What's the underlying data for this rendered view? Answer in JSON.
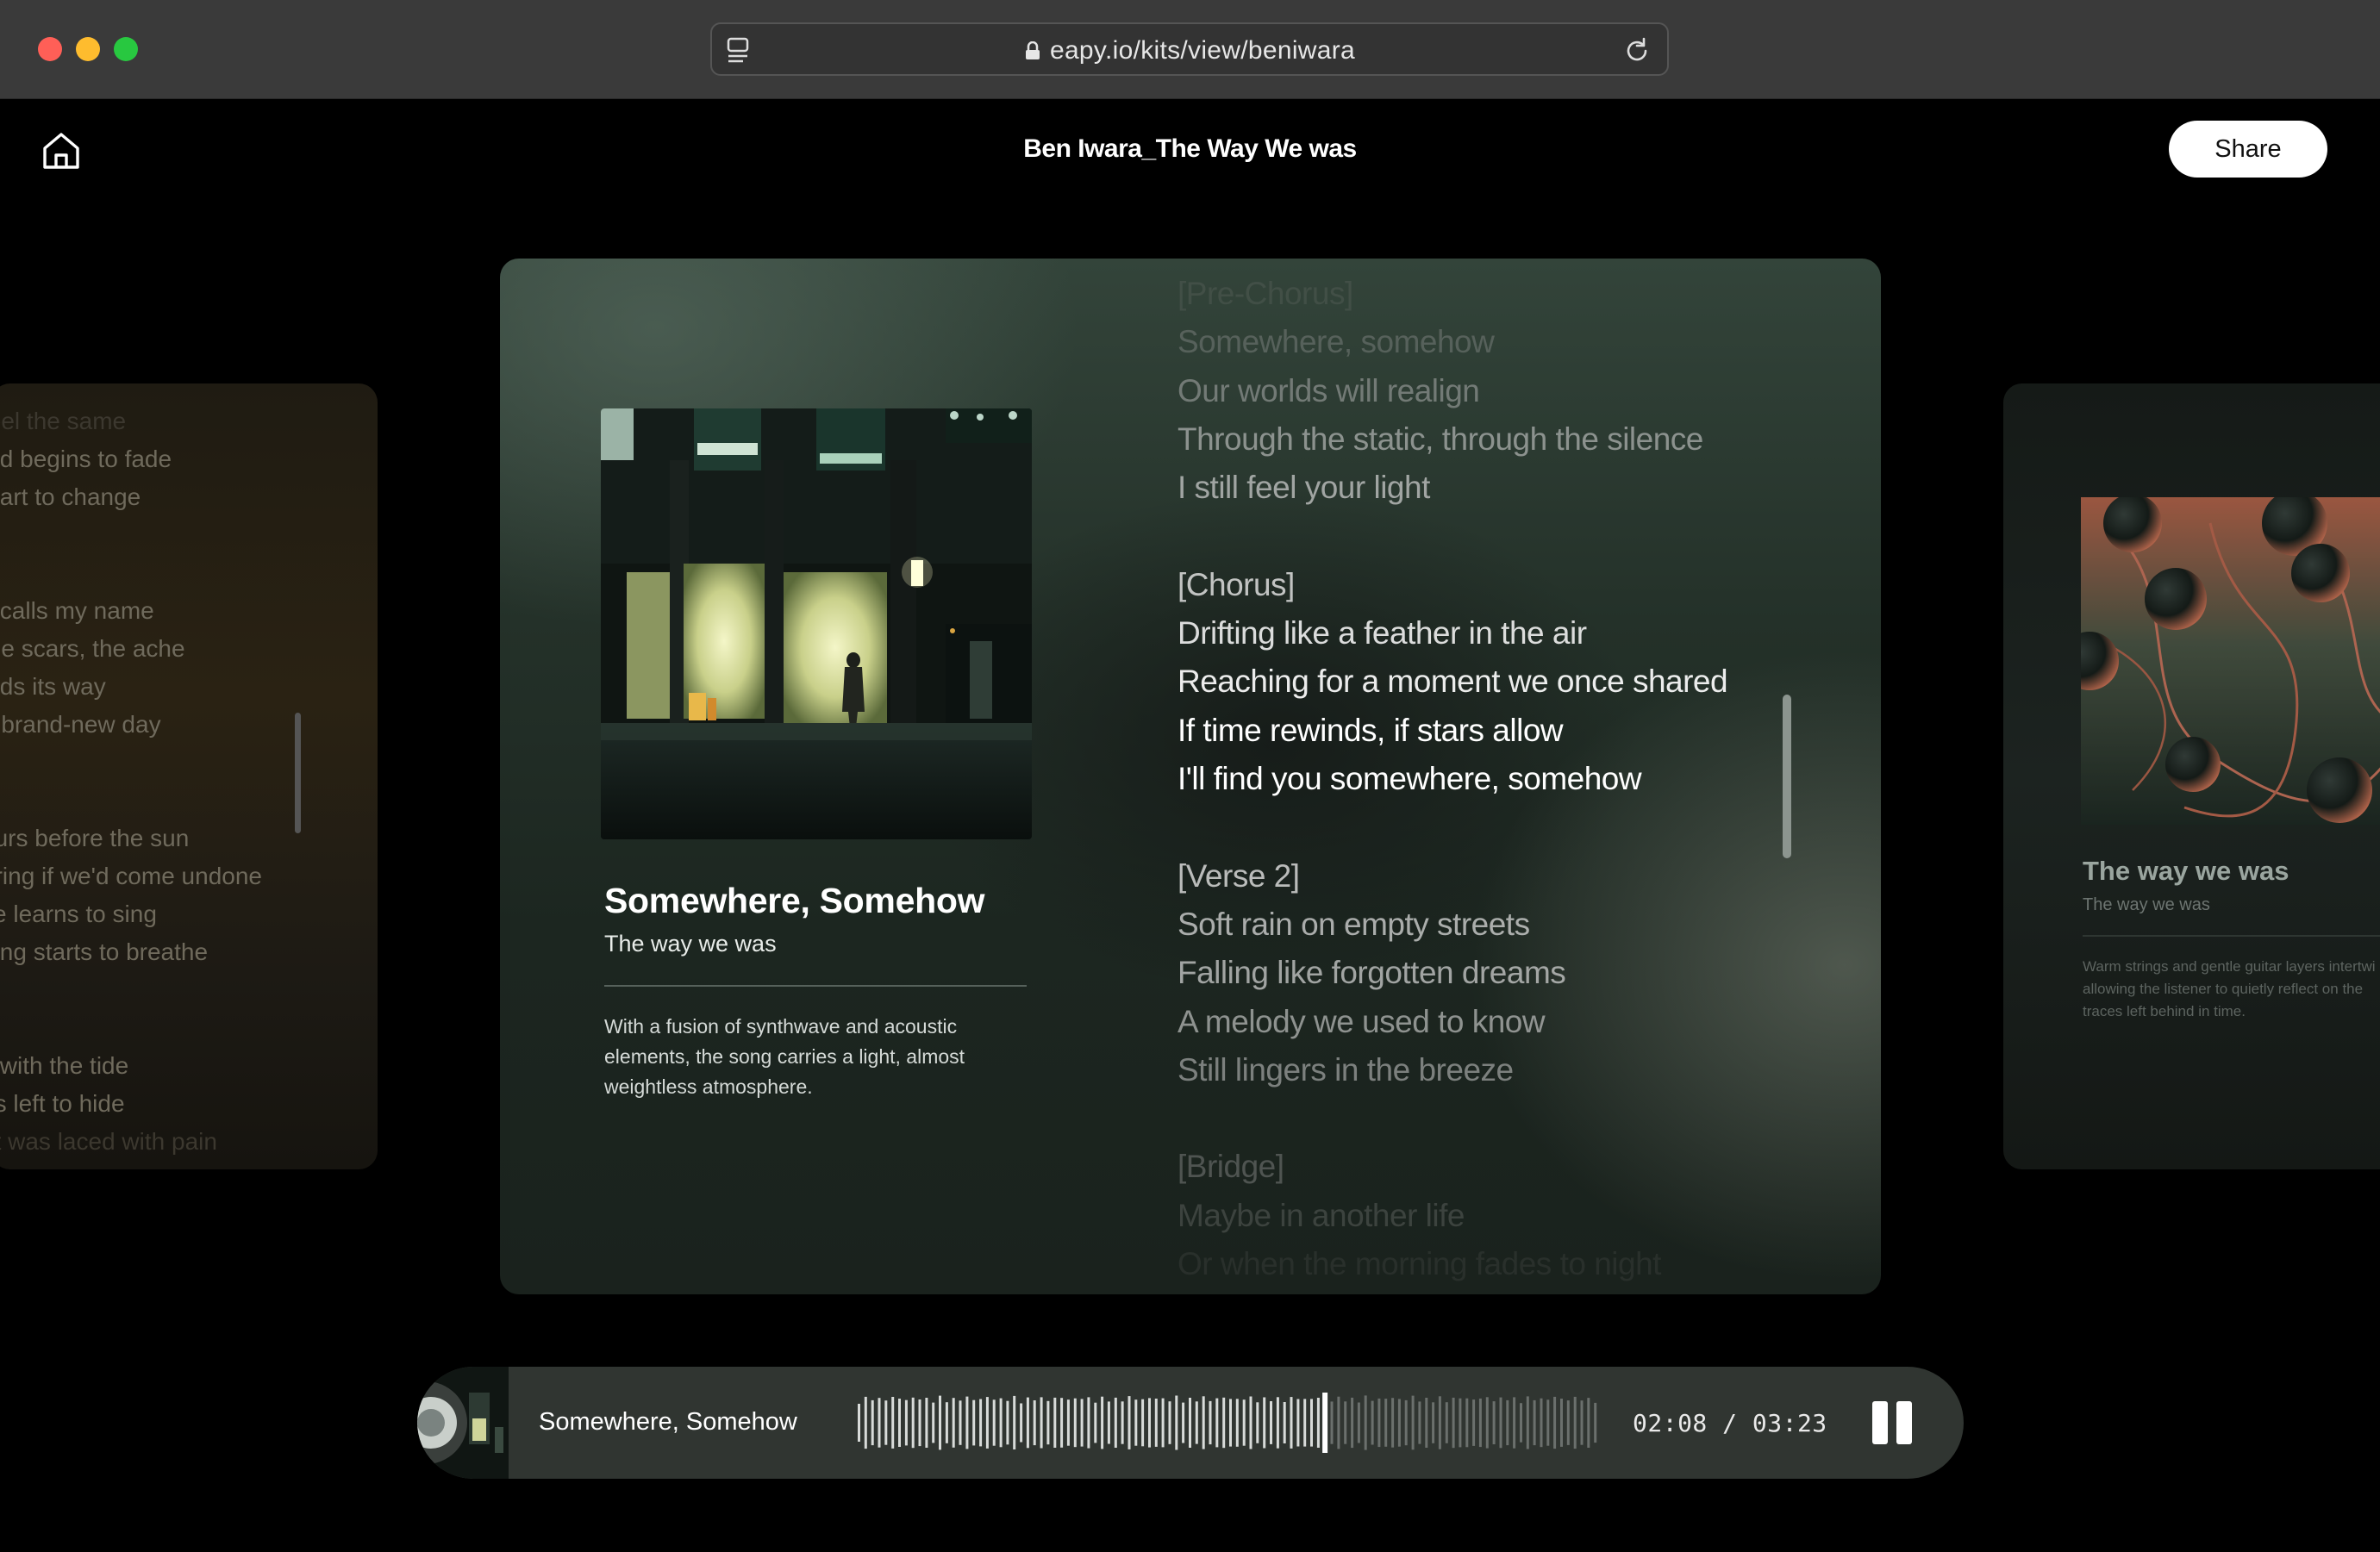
{
  "browser": {
    "url": "eapy.io/kits/view/beniwara"
  },
  "header": {
    "title": "Ben Iwara_The Way We was",
    "share_label": "Share"
  },
  "left_card": {
    "lyric_lines": [
      "feel the same",
      "eld begins to fade",
      "start to change",
      "",
      "",
      "it calls my name",
      "the scars, the ache",
      "inds its way",
      "a brand-new day",
      "",
      "",
      "ours before the sun",
      "ering if we'd come undone",
      "ce learns to sing",
      "ning starts to breathe",
      "",
      "",
      "s with the tide",
      "ns left to hide",
      "ht was laced with pain"
    ]
  },
  "main_card": {
    "song_title": "Somewhere, Somehow",
    "album": "The way we was",
    "description": "With a fusion of synthwave and acoustic elements, the song carries a light, almost weightless atmosphere.",
    "lyrics": [
      {
        "text": "[Pre-Chorus]",
        "opacity": 0.18
      },
      {
        "text": "Somewhere, somehow",
        "opacity": 0.35
      },
      {
        "text": "Our worlds will realign",
        "opacity": 0.5
      },
      {
        "text": "Through the static, through the silence",
        "opacity": 0.62
      },
      {
        "text": "I still feel your light",
        "opacity": 0.7
      },
      {
        "text": "",
        "opacity": 0
      },
      {
        "text": "[Chorus]",
        "opacity": 0.82
      },
      {
        "text": "Drifting like a feather in the air",
        "opacity": 0.9
      },
      {
        "text": "Reaching for a moment we once shared",
        "opacity": 0.95
      },
      {
        "text": "If time rewinds, if stars allow",
        "opacity": 1.0
      },
      {
        "text": "I'll find you somewhere, somehow",
        "opacity": 1.0
      },
      {
        "text": "",
        "opacity": 0
      },
      {
        "text": "[Verse 2]",
        "opacity": 0.8
      },
      {
        "text": "Soft rain on empty streets",
        "opacity": 0.75
      },
      {
        "text": "Falling like forgotten dreams",
        "opacity": 0.72
      },
      {
        "text": "A melody we used to know",
        "opacity": 0.65
      },
      {
        "text": "Still lingers in the breeze",
        "opacity": 0.58
      },
      {
        "text": "",
        "opacity": 0
      },
      {
        "text": "[Bridge]",
        "opacity": 0.38
      },
      {
        "text": "Maybe in another life",
        "opacity": 0.28
      },
      {
        "text": "Or when the morning fades to night",
        "opacity": 0.14
      }
    ]
  },
  "right_card": {
    "title": "The way we was",
    "subtitle": "The way we was",
    "description_lines": [
      "Warm strings and gentle guitar layers intertwi",
      "allowing the listener to quietly reflect on the",
      "traces left behind in time."
    ]
  },
  "player": {
    "track_title": "Somewhere, Somehow",
    "current_time": "02:08",
    "separator": "/",
    "total_time": "03:23",
    "progress": 0.63,
    "state": "playing"
  },
  "icons": {
    "home": "home-icon",
    "lock": "lock-icon",
    "reload": "reload-icon",
    "sidebar": "sidebar-icon",
    "pause": "pause-icon"
  },
  "colors": {
    "share_bg": "#ffffff",
    "traffic_red": "#ff5f57",
    "traffic_yellow": "#febc2e",
    "traffic_green": "#28c840"
  }
}
